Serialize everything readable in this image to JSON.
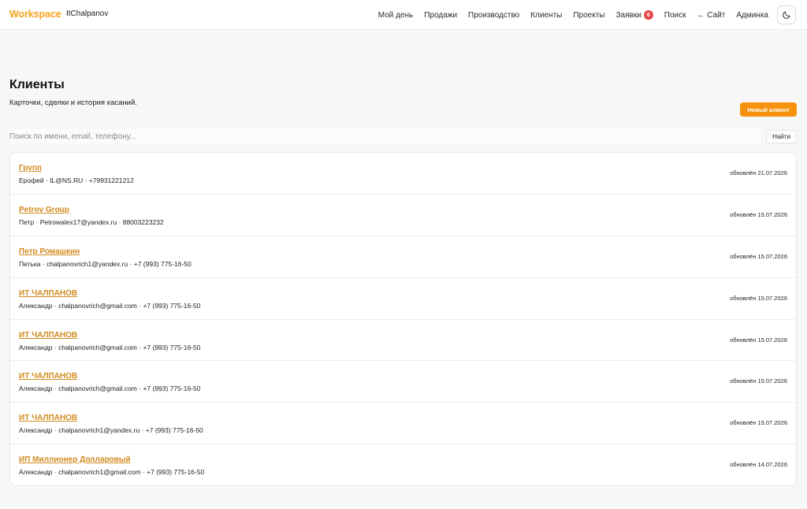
{
  "header": {
    "brand": "Workspace",
    "user": "ItChalpanov",
    "nav": [
      {
        "label": "Мой день"
      },
      {
        "label": "Продажи"
      },
      {
        "label": "Производство"
      },
      {
        "label": "Клиенты"
      },
      {
        "label": "Проекты"
      },
      {
        "label": "Заявки",
        "badge": "6"
      },
      {
        "label": "Поиск"
      },
      {
        "label": "← Сайт"
      },
      {
        "label": "Админка"
      }
    ],
    "theme_icon": "moon-icon"
  },
  "page": {
    "title": "Клиенты",
    "subtitle": "Карточки, сделки и история касаний.",
    "new_button": "Новый клиент"
  },
  "search": {
    "placeholder": "Поиск по имени, email, телефону...",
    "value": "",
    "button": "Найти"
  },
  "clients": [
    {
      "name": "Групп",
      "meta": "Ерофей · IL@NS.RU · +79931221212",
      "updated": "обновлён 21.07.2026"
    },
    {
      "name": "Petrov Group",
      "meta": "Петр · Petrowalex17@yandex.ru · 88003223232",
      "updated": "обновлён 15.07.2026"
    },
    {
      "name": "Петр Ромашкин",
      "meta": "Петька · chalpanovrich1@yandex.ru · +7 (993) 775-16-50",
      "updated": "обновлён 15.07.2026"
    },
    {
      "name": "ИТ ЧАЛПАНОВ",
      "meta": "Александр · chalpanovrich@gmail.com · +7 (993) 775-16-50",
      "updated": "обновлён 15.07.2026"
    },
    {
      "name": "ИТ ЧАЛПАНОВ",
      "meta": "Александр · chalpanovrich@gmail.com · +7 (993) 775-16-50",
      "updated": "обновлён 15.07.2026"
    },
    {
      "name": "ИТ ЧАЛПАНОВ",
      "meta": "Александр · chalpanovrich@gmail.com · +7 (993) 775-16-50",
      "updated": "обновлён 15.07.2026"
    },
    {
      "name": "ИТ ЧАЛПАНОВ",
      "meta": "Александр · chalpanovrich1@yandex.ru · +7 (993) 775-16-50",
      "updated": "обновлён 15.07.2026"
    },
    {
      "name": "ИП Миллионер Долларовый",
      "meta": "Александр · chalpanovrich1@gmail.com · +7 (993) 775-16-50",
      "updated": "обновлён 14.07.2026"
    }
  ],
  "colors": {
    "brand": "#f5a11a",
    "accent_button": "#f7920f",
    "link": "#d18a1c",
    "badge": "#e54848"
  }
}
